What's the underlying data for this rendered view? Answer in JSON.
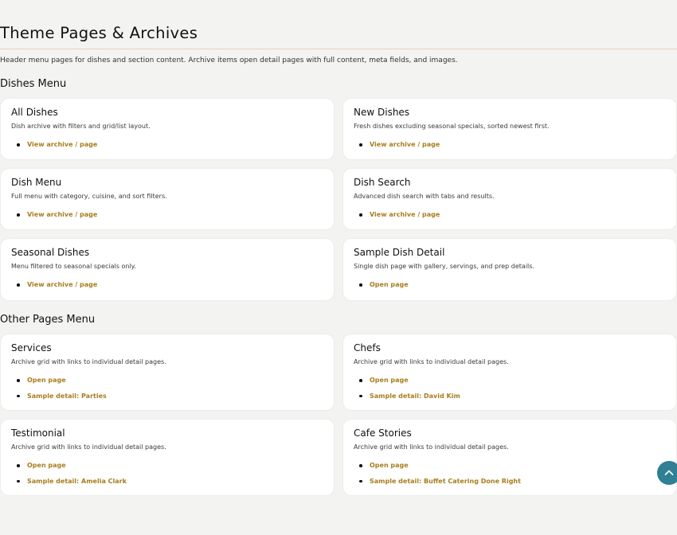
{
  "page": {
    "title": "Theme Pages & Archives",
    "intro": "Header menu pages for dishes and section content. Archive items open detail pages with full content, meta fields, and images."
  },
  "sections": {
    "dishes": {
      "title": "Dishes Menu",
      "cards": [
        {
          "title": "All Dishes",
          "desc": "Dish archive with filters and grid/list layout.",
          "links": [
            "View archive / page"
          ]
        },
        {
          "title": "New Dishes",
          "desc": "Fresh dishes excluding seasonal specials, sorted newest first.",
          "links": [
            "View archive / page"
          ]
        },
        {
          "title": "Dish Menu",
          "desc": "Full menu with category, cuisine, and sort filters.",
          "links": [
            "View archive / page"
          ]
        },
        {
          "title": "Dish Search",
          "desc": "Advanced dish search with tabs and results.",
          "links": [
            "View archive / page"
          ]
        },
        {
          "title": "Seasonal Dishes",
          "desc": "Menu filtered to seasonal specials only.",
          "links": [
            "View archive / page"
          ]
        },
        {
          "title": "Sample Dish Detail",
          "desc": "Single dish page with gallery, servings, and prep details.",
          "links": [
            "Open page"
          ]
        }
      ]
    },
    "other": {
      "title": "Other Pages Menu",
      "cards": [
        {
          "title": "Services",
          "desc": "Archive grid with links to individual detail pages.",
          "links": [
            "Open page",
            "Sample detail: Parties"
          ]
        },
        {
          "title": "Chefs",
          "desc": "Archive grid with links to individual detail pages.",
          "links": [
            "Open page",
            "Sample detail: David Kim"
          ]
        },
        {
          "title": "Testimonial",
          "desc": "Archive grid with links to individual detail pages.",
          "links": [
            "Open page",
            "Sample detail: Amelia Clark"
          ]
        },
        {
          "title": "Cafe Stories",
          "desc": "Archive grid with links to individual detail pages.",
          "links": [
            "Open page",
            "Sample detail: Buffet Catering Done Right"
          ]
        }
      ]
    }
  },
  "colors": {
    "accent": "#a87d1e",
    "fab": "#2f7f95",
    "background": "#f3f3f1"
  },
  "scroll_top": {
    "icon": "chevron-up-icon"
  }
}
